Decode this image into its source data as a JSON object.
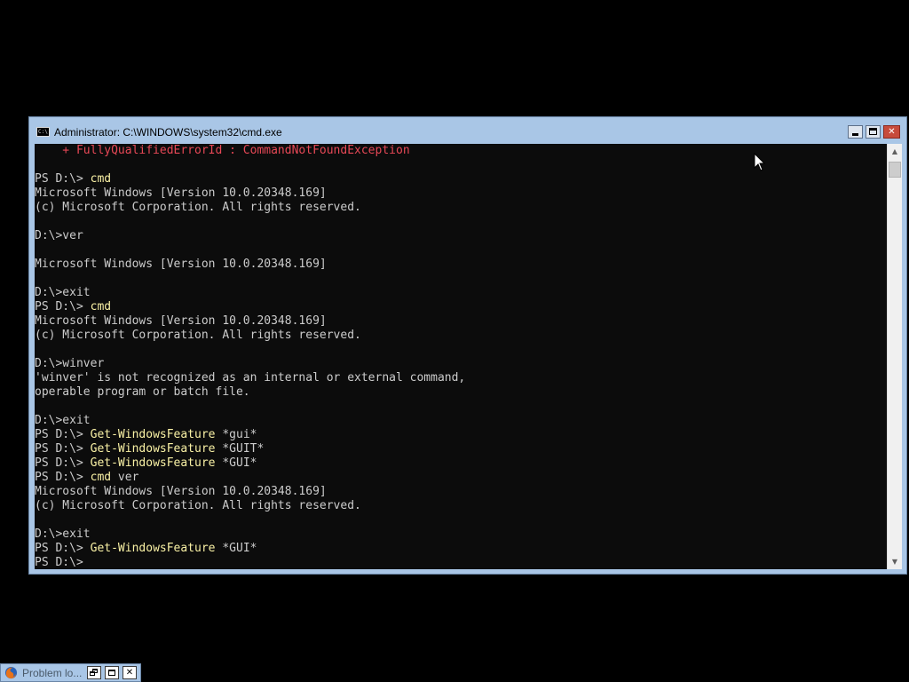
{
  "window": {
    "title": "Administrator: C:\\WINDOWS\\system32\\cmd.exe",
    "icon": "cmd-icon",
    "icon_text": "C:\\"
  },
  "console": {
    "colors": {
      "background": "#0c0c0c",
      "output": "#cccccc",
      "command": "#f9f1a5",
      "error": "#e74856"
    },
    "lines": [
      [
        {
          "t": "    + FullyQualifiedErrorId : CommandNotFoundException",
          "c": "err"
        }
      ],
      [],
      [
        {
          "t": "PS D:\\> ",
          "c": "out"
        },
        {
          "t": "cmd",
          "c": "cmd"
        }
      ],
      [
        {
          "t": "Microsoft Windows [Version 10.0.20348.169]",
          "c": "out"
        }
      ],
      [
        {
          "t": "(c) Microsoft Corporation. All rights reserved.",
          "c": "out"
        }
      ],
      [],
      [
        {
          "t": "D:\\>ver",
          "c": "out"
        }
      ],
      [],
      [
        {
          "t": "Microsoft Windows [Version 10.0.20348.169]",
          "c": "out"
        }
      ],
      [],
      [
        {
          "t": "D:\\>exit",
          "c": "out"
        }
      ],
      [
        {
          "t": "PS D:\\> ",
          "c": "out"
        },
        {
          "t": "cmd",
          "c": "cmd"
        }
      ],
      [
        {
          "t": "Microsoft Windows [Version 10.0.20348.169]",
          "c": "out"
        }
      ],
      [
        {
          "t": "(c) Microsoft Corporation. All rights reserved.",
          "c": "out"
        }
      ],
      [],
      [
        {
          "t": "D:\\>winver",
          "c": "out"
        }
      ],
      [
        {
          "t": "'winver' is not recognized as an internal or external command,",
          "c": "out"
        }
      ],
      [
        {
          "t": "operable program or batch file.",
          "c": "out"
        }
      ],
      [],
      [
        {
          "t": "D:\\>exit",
          "c": "out"
        }
      ],
      [
        {
          "t": "PS D:\\> ",
          "c": "out"
        },
        {
          "t": "Get-WindowsFeature",
          "c": "cmd"
        },
        {
          "t": " *gui*",
          "c": "out"
        }
      ],
      [
        {
          "t": "PS D:\\> ",
          "c": "out"
        },
        {
          "t": "Get-WindowsFeature",
          "c": "cmd"
        },
        {
          "t": " *GUIT*",
          "c": "out"
        }
      ],
      [
        {
          "t": "PS D:\\> ",
          "c": "out"
        },
        {
          "t": "Get-WindowsFeature",
          "c": "cmd"
        },
        {
          "t": " *GUI*",
          "c": "out"
        }
      ],
      [
        {
          "t": "PS D:\\> ",
          "c": "out"
        },
        {
          "t": "cmd",
          "c": "cmd"
        },
        {
          "t": " ver",
          "c": "out"
        }
      ],
      [
        {
          "t": "Microsoft Windows [Version 10.0.20348.169]",
          "c": "out"
        }
      ],
      [
        {
          "t": "(c) Microsoft Corporation. All rights reserved.",
          "c": "out"
        }
      ],
      [],
      [
        {
          "t": "D:\\>exit",
          "c": "out"
        }
      ],
      [
        {
          "t": "PS D:\\> ",
          "c": "out"
        },
        {
          "t": "Get-WindowsFeature",
          "c": "cmd"
        },
        {
          "t": " *GUI*",
          "c": "out"
        }
      ],
      [
        {
          "t": "PS D:\\>",
          "c": "out"
        }
      ]
    ]
  },
  "scrollbar": {
    "up_icon": "scroll-up-arrow-icon",
    "down_icon": "scroll-down-arrow-icon",
    "position": "bottom"
  },
  "minimized_window": {
    "title": "Problem lo...",
    "icon": "firefox-icon"
  }
}
